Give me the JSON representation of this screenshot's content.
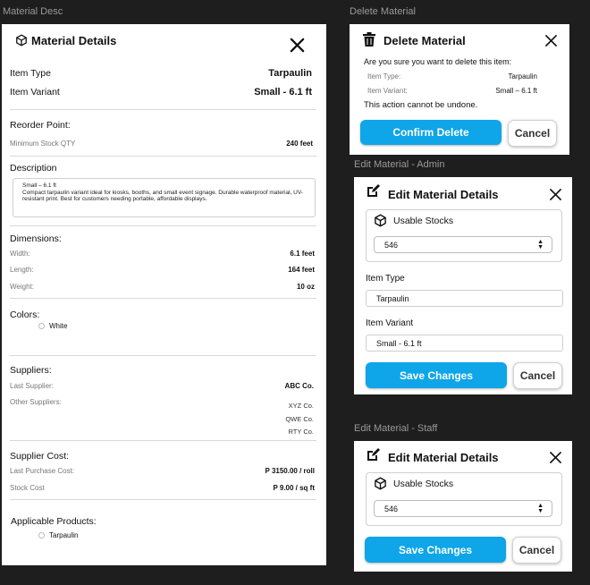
{
  "frames": {
    "desc_label": "Material Desc",
    "delete_label": "Delete Material",
    "edit_admin_label": "Edit Material - Admin",
    "edit_staff_label": "Edit Material - Staff"
  },
  "details": {
    "title": "Material Details",
    "item_type_label": "Item Type",
    "item_type_value": "Tarpaulin",
    "item_variant_label": "Item Variant",
    "item_variant_value": "Small - 6.1 ft",
    "reorder_heading": "Reorder Point:",
    "min_stock_label": "Minimum Stock QTY",
    "min_stock_value": "240 feet",
    "description_heading": "Description",
    "description_line1": "Small – 6.1 ft",
    "description_body": "Compact tarpaulin variant ideal for kiosks, booths, and small event signage. Durable waterproof material, UV-resistant print. Best for customers needing portable, affordable displays.",
    "dimensions_heading": "Dimensions:",
    "width_label": "Width:",
    "width_value": "6.1 feet",
    "length_label": "Length:",
    "length_value": "164 feet",
    "weight_label": "Weight:",
    "weight_value": "10 oz",
    "colors_heading": "Colors:",
    "color_option": "White",
    "suppliers_heading": "Suppliers:",
    "last_supplier_label": "Last Supplier:",
    "last_supplier_value": "ABC Co.",
    "other_suppliers_label": "Other Suppliers:",
    "other_suppliers": [
      "XYZ Co.",
      "QWE Co.",
      "RTY Co."
    ],
    "supplier_cost_heading": "Supplier Cost:",
    "last_purchase_label": "Last Purchase Cost:",
    "last_purchase_value": "P 3150.00 / roll",
    "stock_cost_label": "Stock Cost",
    "stock_cost_value": "P 9.00 / sq ft",
    "applicable_heading": "Applicable Products:",
    "applicable_option": "Tarpaulin"
  },
  "delete": {
    "title": "Delete Material",
    "question": "Are you sure you want to delete this item:",
    "item_type_label": "Item Type:",
    "item_type_value": "Tarpaulin",
    "item_variant_label": "Item Variant:",
    "item_variant_value": "Small – 6.1 ft",
    "warning": "This action cannot be undone.",
    "confirm_label": "Confirm Delete",
    "cancel_label": "Cancel"
  },
  "edit_admin": {
    "title": "Edit Material Details",
    "stocks_label": "Usable Stocks",
    "stocks_value": "546",
    "item_type_label": "Item Type",
    "item_type_value": "Tarpaulin",
    "item_variant_label": "Item Variant",
    "item_variant_value": "Small - 6.1 ft",
    "save_label": "Save Changes",
    "cancel_label": "Cancel"
  },
  "edit_staff": {
    "title": "Edit Material Details",
    "stocks_label": "Usable Stocks",
    "stocks_value": "546",
    "save_label": "Save Changes",
    "cancel_label": "Cancel"
  },
  "icons": {
    "box": "box-icon",
    "close": "close-icon",
    "trash": "trash-icon",
    "edit": "edit-icon",
    "stepper": "stepper-arrows-icon"
  },
  "colors": {
    "primary": "#0ea5e9",
    "background": "#1e1e1e"
  }
}
